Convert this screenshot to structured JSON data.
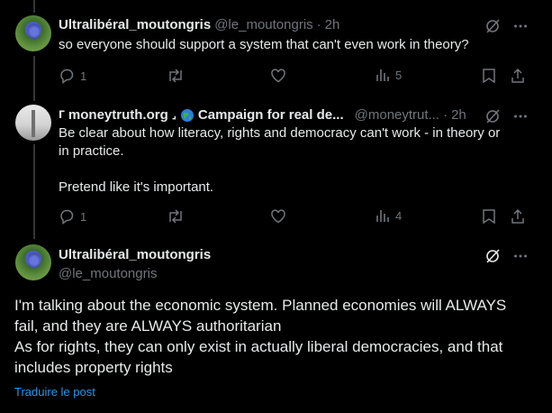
{
  "tweets": [
    {
      "name": "Ultralibéral_moutongris",
      "handle": "@le_moutongris",
      "time": "2h",
      "text": "so everyone should support a system that can't even work in theory?",
      "replies": "1",
      "views": "5"
    },
    {
      "name_prefix": "ᒥ",
      "name_main": "moneytruth.org",
      "name_sep": "⌟",
      "name_rest": "Campaign for real de...",
      "handle": "@moneytrut...",
      "time": "2h",
      "text_lines": [
        "Be clear about how literacy, rights and democracy can't work - in theory or",
        "in practice.",
        "",
        "Pretend like it's important."
      ],
      "replies": "1",
      "views": "4"
    },
    {
      "name": "Ultralibéral_moutongris",
      "handle": "@le_moutongris",
      "text_lines": [
        "I'm talking about the economic system. Planned economies will ALWAYS",
        "fail, and they are ALWAYS authoritarian",
        "As for rights, they can only exist in actually liberal democracies, and that",
        "includes property rights"
      ],
      "translate": "Traduire le post"
    }
  ],
  "icons": {
    "grok": "grok-slash-icon",
    "more": "more-dots-icon",
    "reply": "reply-icon",
    "retweet": "retweet-icon",
    "like": "heart-icon",
    "views": "views-chart-icon",
    "bookmark": "bookmark-icon",
    "share": "share-icon",
    "globe": "globe-emoji"
  },
  "colors": {
    "background": "#000000",
    "text": "#e7e9ea",
    "muted": "#71767b",
    "link": "#1d9bf0"
  }
}
